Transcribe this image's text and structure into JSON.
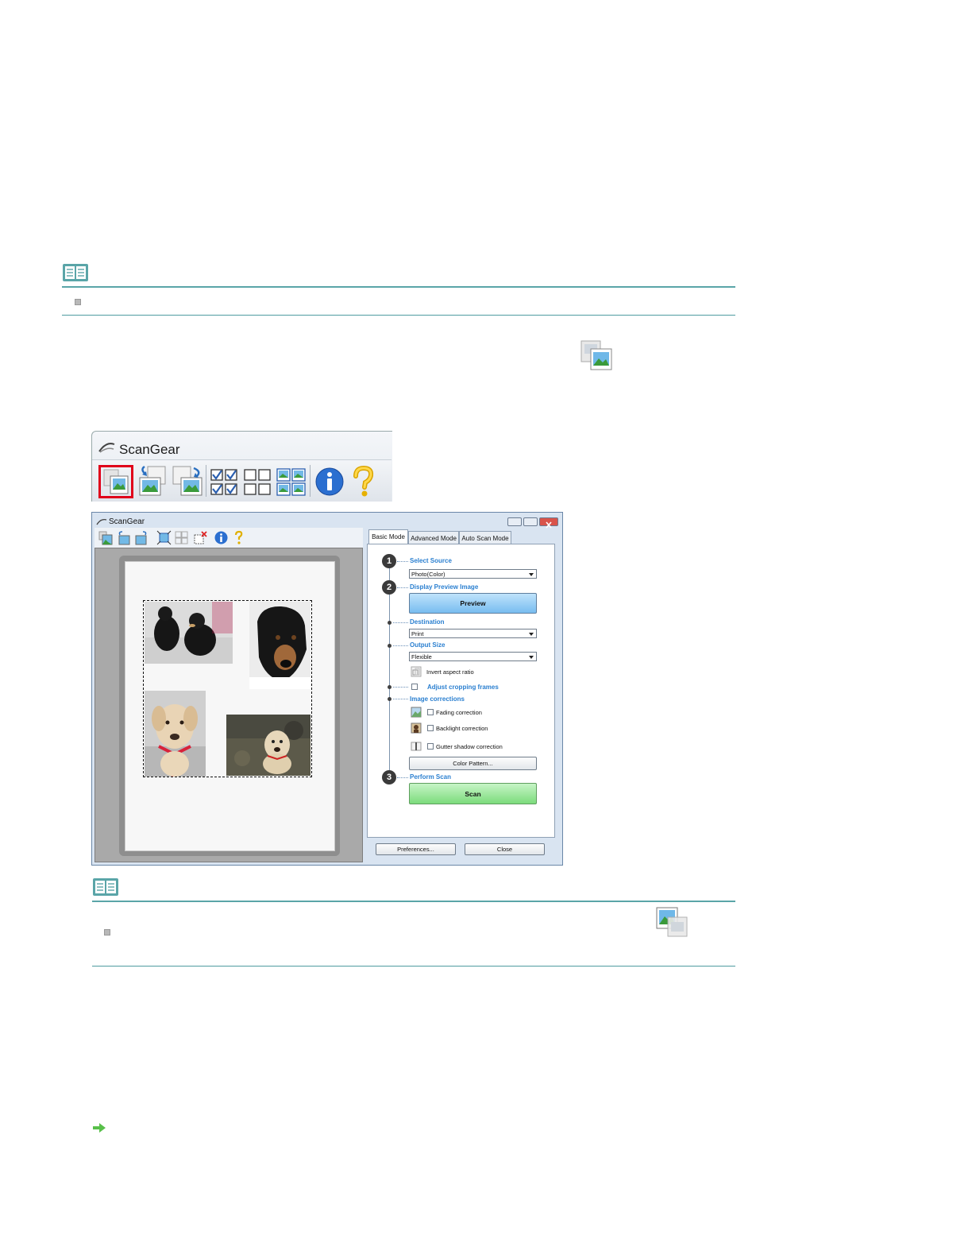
{
  "scangear_toolbar": {
    "title": "ScanGear"
  },
  "scangear_window": {
    "title": "ScanGear",
    "tabs": [
      "Basic Mode",
      "Advanced Mode",
      "Auto Scan Mode"
    ],
    "steps": {
      "step1": "1",
      "step2": "2",
      "step3": "3"
    },
    "select_source": {
      "label": "Select Source",
      "value": "Photo(Color)"
    },
    "display_preview": {
      "label": "Display Preview Image",
      "button": "Preview"
    },
    "destination": {
      "label": "Destination",
      "value": "Print"
    },
    "output_size": {
      "label": "Output Size",
      "value": "Flexible"
    },
    "invert_aspect_ratio": "Invert aspect ratio",
    "adjust_cropping_frames": "Adjust cropping frames",
    "image_corrections": {
      "label": "Image corrections",
      "fading": "Fading correction",
      "backlight": "Backlight correction",
      "gutter": "Gutter shadow correction",
      "color_pattern_button": "Color Pattern..."
    },
    "perform_scan": {
      "label": "Perform Scan",
      "button": "Scan"
    },
    "preferences_button": "Preferences...",
    "close_button": "Close"
  },
  "colors": {
    "note_rule": "#5aa5a8",
    "highlight_box": "#e0001a",
    "blue_label": "#2a7fd0",
    "preview_button": "#8cc8f5",
    "scan_button": "#8ee58e"
  }
}
